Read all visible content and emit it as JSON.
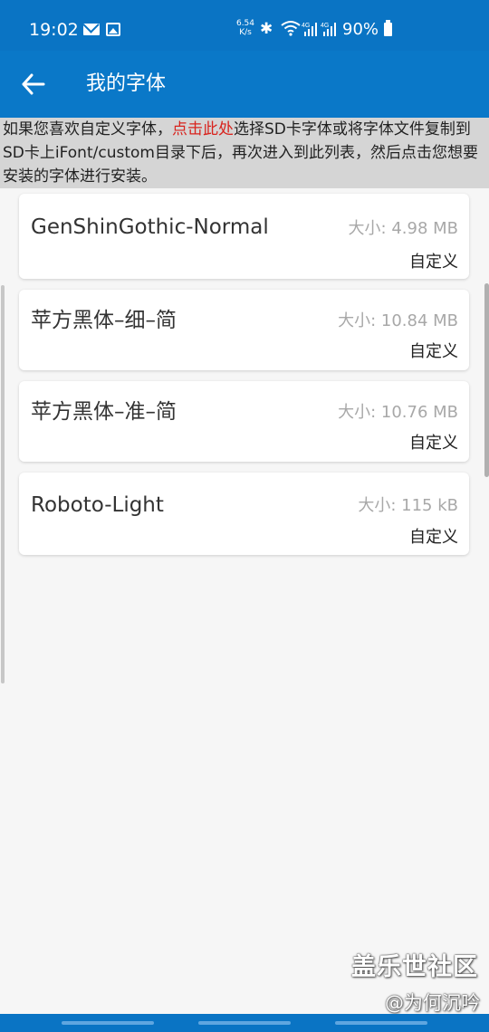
{
  "status_bar": {
    "time": "19:02",
    "net_speed_value": "6.54",
    "net_speed_unit": "K/s",
    "battery": "90%",
    "icons": [
      "mail-icon",
      "gallery-icon",
      "bluetooth-icon",
      "wifi-icon",
      "signal-4g-icon",
      "signal-4g-icon",
      "battery-icon"
    ]
  },
  "app_bar": {
    "back_icon": "arrow-left-icon",
    "title": "我的字体"
  },
  "notice": {
    "text_before": "如果您喜欢自定义字体，",
    "link": "点击此处",
    "text_after": "选择SD卡字体或将字体文件复制到SD卡上iFont/custom目录下后，再次进入到此列表，然后点击您想要安装的字体进行安装。",
    "link_color": "#d8231d"
  },
  "fonts": [
    {
      "name": "GenShinGothic-Normal",
      "size": "大小: 4.98 MB",
      "type": "自定义"
    },
    {
      "name": "苹方黑体–细–简",
      "size": "大小: 10.84 MB",
      "type": "自定义"
    },
    {
      "name": "苹方黑体–准–简",
      "size": "大小: 10.76 MB",
      "type": "自定义"
    },
    {
      "name": "Roboto-Light",
      "size": "大小: 115 kB",
      "type": "自定义"
    }
  ],
  "watermark": {
    "community": "盖乐世社区",
    "author": "@为何沉吟"
  },
  "colors": {
    "primary": "#0a78c8",
    "status_bar": "#0a74c4",
    "notice_bg": "#d5d5d5"
  }
}
